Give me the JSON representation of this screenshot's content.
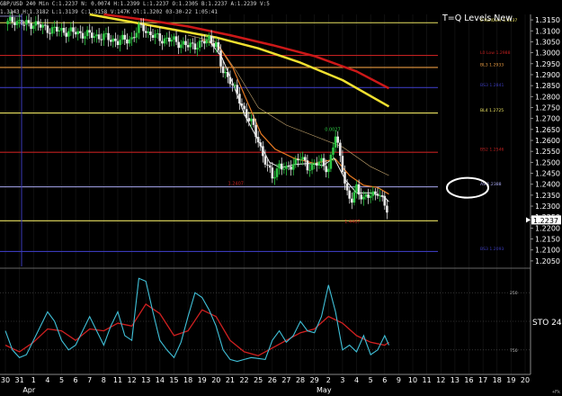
{
  "header": {
    "line1": "GBP/USD 240 Min  C:1.2237  N: 0.0074  H:1.2399  L:1.2237  O:1.2305  B:1.2237  A:1.2239  V:53.1K  Ol:0",
    "line2": "1.3143  H:1.3182  L:1.3139  C:1.3158  V:147K  Ol:1.3202  03-30-22 1:05:41"
  },
  "title": "T=Q Levels New",
  "indicator_label": "STO",
  "indicator_value_text": "24",
  "corner_label": "+Fk",
  "colors": {
    "background": "#000000",
    "candle_up": "#2ec844",
    "candle_down": "#e8e8e8",
    "ma_fast": "#f0f0f0",
    "ma_orange": "#e87a22",
    "ma_tan": "#c8a870",
    "ma_yellow": "#f0e030",
    "ma_red": "#cc1818",
    "level_yellow": "#e8e060",
    "level_orange": "#e89a40",
    "level_red": "#c02020",
    "level_blue": "#3a3ab8",
    "level_lavender": "#a8a8f0",
    "stoch_k": "#40c0d8",
    "stoch_d": "#d02020",
    "price_box": "#ffffff"
  },
  "chart_data": {
    "type": "line",
    "title": "T=Q Levels New",
    "price_axis": {
      "ylim": [
        1.2025,
        1.3175
      ],
      "ticks": [
        "1.3150",
        "1.3100",
        "1.3050",
        "1.3000",
        "1.2950",
        "1.2900",
        "1.2850",
        "1.2800",
        "1.2750",
        "1.2700",
        "1.2650",
        "1.2600",
        "1.2550",
        "1.2500",
        "1.2450",
        "1.2400",
        "1.2350",
        "1.2300",
        "1.2250",
        "1.2200",
        "1.2150",
        "1.2100",
        "1.2050"
      ],
      "last_price": "1.2237"
    },
    "time_axis": {
      "ticks": [
        "30",
        "31",
        "1",
        "4",
        "5",
        "6",
        "7",
        "8",
        "11",
        "12",
        "13",
        "14",
        "15",
        "18",
        "19",
        "20",
        "21",
        "22",
        "25",
        "26",
        "27",
        "28",
        "29",
        "2",
        "3",
        "4",
        "5",
        "6",
        "9",
        "10",
        "11",
        "12",
        "13",
        "16",
        "17",
        "18",
        "19",
        "20"
      ],
      "ticks_per_day": 6,
      "months": [
        {
          "label": "Apr",
          "tick": 2
        },
        {
          "label": "May",
          "tick": 23
        }
      ]
    },
    "levels": [
      {
        "label": "0 RollOver 1.3137",
        "value": 1.3137,
        "color": "level_yellow"
      },
      {
        "label": "L0 Low 1.2988",
        "value": 1.2988,
        "color": "level_red"
      },
      {
        "label": "BL3 1.2933",
        "value": 1.2933,
        "color": "level_orange"
      },
      {
        "label": "BS3 1.2841",
        "value": 1.2841,
        "color": "level_blue"
      },
      {
        "label": "BL4 1.2725",
        "value": 1.2725,
        "color": "level_yellow"
      },
      {
        "label": "BS2 1.2546",
        "value": 1.2546,
        "color": "level_red"
      },
      {
        "label": "AS 1.2388",
        "value": 1.2388,
        "color": "level_lavender",
        "circled": true
      },
      {
        "label": "",
        "value": 1.2233,
        "color": "level_yellow"
      },
      {
        "label": "BS3 1.2093",
        "value": 1.2093,
        "color": "level_blue"
      }
    ],
    "annotations": [
      {
        "text": "0.0027",
        "color": "candle_up",
        "near_tick": 23.3,
        "value": 1.2643
      },
      {
        "text": "1.2407",
        "color": "level_red",
        "near_tick": 16.4,
        "value": 1.2397
      },
      {
        "text": "1.4407",
        "color": "level_red",
        "near_tick": 24.7,
        "value": 1.2222
      }
    ],
    "candle_path": [
      [
        0,
        1.313
      ],
      [
        0.4,
        1.3144
      ],
      [
        0.7,
        1.315
      ],
      [
        1.3,
        1.3128
      ],
      [
        2,
        1.3134
      ],
      [
        3,
        1.3108
      ],
      [
        4,
        1.31
      ],
      [
        5,
        1.3092
      ],
      [
        6,
        1.308
      ],
      [
        7,
        1.3072
      ],
      [
        8,
        1.3052
      ],
      [
        9,
        1.3065
      ],
      [
        9.5,
        1.311
      ],
      [
        9.8,
        1.312
      ],
      [
        10.2,
        1.3085
      ],
      [
        11,
        1.3065
      ],
      [
        12,
        1.3055
      ],
      [
        13,
        1.303
      ],
      [
        14,
        1.3042
      ],
      [
        14.5,
        1.3065
      ],
      [
        15,
        1.304
      ],
      [
        15.4,
        1.292
      ],
      [
        16,
        1.288
      ],
      [
        16.8,
        1.276
      ],
      [
        17.5,
        1.268
      ],
      [
        18,
        1.26
      ],
      [
        18.3,
        1.254
      ],
      [
        18.7,
        1.247
      ],
      [
        19,
        1.243
      ],
      [
        19.5,
        1.249
      ],
      [
        20,
        1.246
      ],
      [
        20.5,
        1.25
      ],
      [
        21,
        1.252
      ],
      [
        21.5,
        1.248
      ],
      [
        22,
        1.249
      ],
      [
        22.5,
        1.25
      ],
      [
        23,
        1.247
      ],
      [
        23.5,
        1.262
      ],
      [
        24,
        1.248
      ],
      [
        24.3,
        1.236
      ],
      [
        24.6,
        1.231
      ],
      [
        25,
        1.239
      ],
      [
        25.5,
        1.233
      ],
      [
        26,
        1.235
      ],
      [
        26.5,
        1.237
      ],
      [
        27,
        1.23
      ],
      [
        27.3,
        1.2268
      ]
    ],
    "series": [
      {
        "name": "",
        "color": "ma_yellow",
        "width": 2.5,
        "points": [
          [
            6,
            1.3175
          ],
          [
            9,
            1.314
          ],
          [
            12,
            1.3105
          ],
          [
            15,
            1.307
          ],
          [
            18,
            1.302
          ],
          [
            21,
            1.2955
          ],
          [
            24,
            1.2875
          ],
          [
            27.3,
            1.2755
          ]
        ]
      },
      {
        "name": "",
        "color": "ma_red",
        "width": 2.5,
        "points": [
          [
            7,
            1.3175
          ],
          [
            10,
            1.315
          ],
          [
            13,
            1.312
          ],
          [
            16,
            1.308
          ],
          [
            19,
            1.3035
          ],
          [
            22,
            1.2985
          ],
          [
            25,
            1.2915
          ],
          [
            27.3,
            1.2838
          ]
        ]
      },
      {
        "name": "",
        "color": "ma_tan",
        "width": 0.6,
        "points": [
          [
            13,
            1.308
          ],
          [
            15,
            1.305
          ],
          [
            16.5,
            1.291
          ],
          [
            18,
            1.275
          ],
          [
            20,
            1.267
          ],
          [
            22,
            1.262
          ],
          [
            24,
            1.257
          ],
          [
            26,
            1.248
          ],
          [
            27.3,
            1.244
          ]
        ]
      },
      {
        "name": "",
        "color": "ma_orange",
        "width": 1.2,
        "points": [
          [
            14,
            1.306
          ],
          [
            15.2,
            1.303
          ],
          [
            16.2,
            1.293
          ],
          [
            17.2,
            1.278
          ],
          [
            18.2,
            1.263
          ],
          [
            19.2,
            1.256
          ],
          [
            20.5,
            1.252
          ],
          [
            22,
            1.2495
          ],
          [
            23.5,
            1.2515
          ],
          [
            24.5,
            1.244
          ],
          [
            25.5,
            1.2395
          ],
          [
            26.5,
            1.2385
          ],
          [
            27.3,
            1.2355
          ]
        ]
      },
      {
        "name": "",
        "color": "ma_fast",
        "width": 1.0,
        "points": [
          [
            14.5,
            1.3055
          ],
          [
            15.4,
            1.298
          ],
          [
            16.2,
            1.286
          ],
          [
            17,
            1.272
          ],
          [
            18,
            1.26
          ],
          [
            18.8,
            1.25
          ],
          [
            19.6,
            1.2475
          ],
          [
            20.6,
            1.249
          ],
          [
            21.6,
            1.2495
          ],
          [
            22.6,
            1.2485
          ],
          [
            23.4,
            1.252
          ],
          [
            24.2,
            1.242
          ],
          [
            25,
            1.236
          ],
          [
            26,
            1.236
          ],
          [
            27,
            1.234
          ],
          [
            27.3,
            1.232
          ]
        ]
      }
    ],
    "stochastic": {
      "ylim": [
        0,
        100
      ],
      "levels": [
        80,
        50,
        20
      ],
      "level_labels": [
        "250",
        "750"
      ],
      "k": [
        [
          0,
          40
        ],
        [
          0.5,
          20
        ],
        [
          1,
          12
        ],
        [
          1.5,
          15
        ],
        [
          2,
          30
        ],
        [
          2.5,
          45
        ],
        [
          3,
          60
        ],
        [
          3.5,
          50
        ],
        [
          4,
          30
        ],
        [
          4.5,
          20
        ],
        [
          5,
          25
        ],
        [
          5.5,
          40
        ],
        [
          6,
          55
        ],
        [
          6.5,
          40
        ],
        [
          7,
          25
        ],
        [
          7.5,
          45
        ],
        [
          8,
          60
        ],
        [
          8.5,
          35
        ],
        [
          9,
          30
        ],
        [
          9.5,
          95
        ],
        [
          10,
          92
        ],
        [
          10.5,
          60
        ],
        [
          11,
          30
        ],
        [
          11.5,
          20
        ],
        [
          12,
          12
        ],
        [
          12.5,
          28
        ],
        [
          13,
          55
        ],
        [
          13.5,
          80
        ],
        [
          14,
          75
        ],
        [
          14.5,
          62
        ],
        [
          15,
          45
        ],
        [
          15.5,
          20
        ],
        [
          16,
          10
        ],
        [
          16.5,
          8
        ],
        [
          17,
          10
        ],
        [
          17.5,
          12
        ],
        [
          18,
          11
        ],
        [
          18.5,
          10
        ],
        [
          19,
          30
        ],
        [
          19.5,
          40
        ],
        [
          20,
          28
        ],
        [
          20.5,
          35
        ],
        [
          21,
          50
        ],
        [
          21.5,
          40
        ],
        [
          22,
          38
        ],
        [
          22.5,
          55
        ],
        [
          23,
          88
        ],
        [
          23.5,
          60
        ],
        [
          24,
          20
        ],
        [
          24.5,
          25
        ],
        [
          25,
          18
        ],
        [
          25.5,
          35
        ],
        [
          26,
          15
        ],
        [
          26.5,
          20
        ],
        [
          27,
          35
        ],
        [
          27.3,
          25
        ]
      ],
      "d": [
        [
          0,
          25
        ],
        [
          1,
          18
        ],
        [
          2,
          28
        ],
        [
          3,
          42
        ],
        [
          4,
          40
        ],
        [
          5,
          30
        ],
        [
          6,
          42
        ],
        [
          7,
          40
        ],
        [
          8,
          48
        ],
        [
          9,
          45
        ],
        [
          10,
          68
        ],
        [
          11,
          58
        ],
        [
          12,
          35
        ],
        [
          13,
          40
        ],
        [
          14,
          62
        ],
        [
          15,
          55
        ],
        [
          16,
          30
        ],
        [
          17,
          18
        ],
        [
          18,
          14
        ],
        [
          19,
          22
        ],
        [
          20,
          30
        ],
        [
          21,
          38
        ],
        [
          22,
          42
        ],
        [
          23,
          55
        ],
        [
          24,
          48
        ],
        [
          25,
          35
        ],
        [
          26,
          28
        ],
        [
          27,
          25
        ],
        [
          27.3,
          28
        ]
      ]
    }
  }
}
